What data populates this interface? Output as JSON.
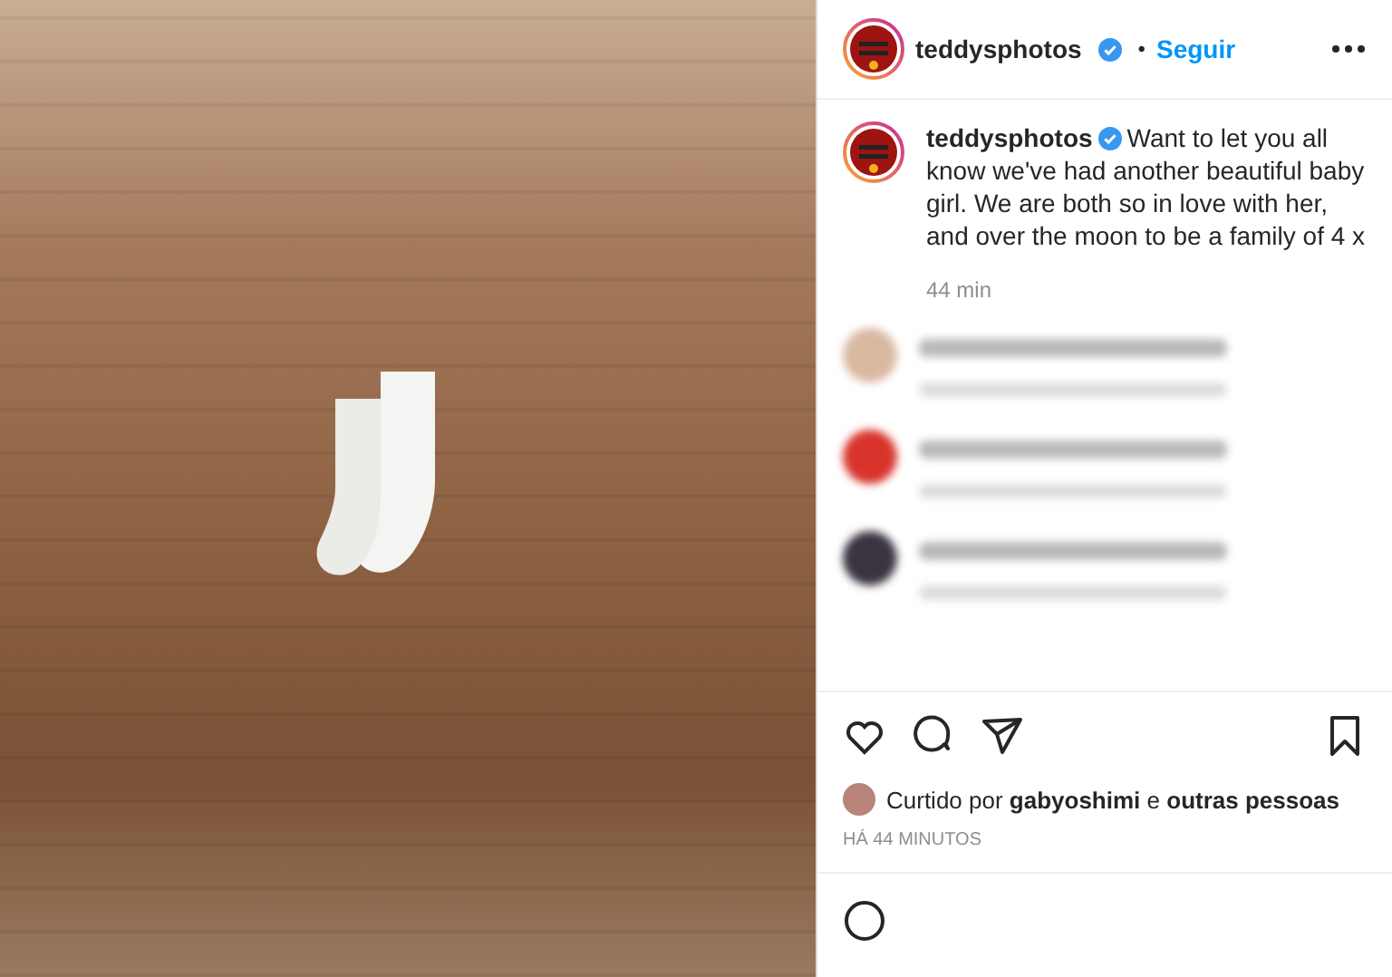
{
  "post": {
    "username": "teddysphotos",
    "verified": true,
    "separator": "•",
    "follow": "Seguir"
  },
  "caption": {
    "username": "teddysphotos",
    "verified": true,
    "text": "Want to let you all know we've had another beautiful baby girl. We are both so in love with her, and over the moon to be a family of 4 x",
    "time": "44 min"
  },
  "comments": [
    {
      "color": "#d9b8a0"
    },
    {
      "color": "#d8342c"
    },
    {
      "color": "#3a3340"
    }
  ],
  "actions": {
    "liked": false,
    "saved": false
  },
  "likes": "Curtido por **gabyoshimi** e **outras pessoas**",
  "timestamp": "HÁ 44 MINUTOS"
}
